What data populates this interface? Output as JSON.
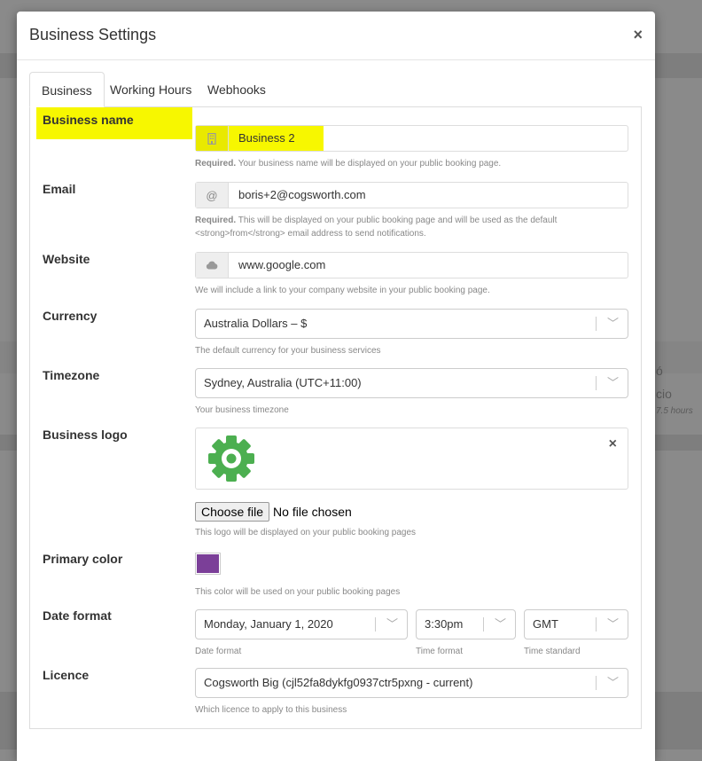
{
  "modal": {
    "title": "Business Settings",
    "close_label": "×"
  },
  "tabs": [
    {
      "label": "Business",
      "active": true
    },
    {
      "label": "Working Hours",
      "active": false
    },
    {
      "label": "Webhooks",
      "active": false
    }
  ],
  "fields": {
    "business_name": {
      "label": "Business name",
      "value": "Business 2",
      "icon": "building-icon",
      "help_strong": "Required.",
      "help": " Your business name will be displayed on your public booking page."
    },
    "email": {
      "label": "Email",
      "value": "boris+2@cogsworth.com",
      "icon": "at-icon",
      "help_strong": "Required.",
      "help": " This will be displayed on your public booking page and will be used as the default",
      "help_line2": "<strong>from</strong> email address to send notifications."
    },
    "website": {
      "label": "Website",
      "value": "www.google.com",
      "icon": "cloud-icon",
      "help": "We will include a link to your company website in your public booking page."
    },
    "currency": {
      "label": "Currency",
      "value": "Australia Dollars – $",
      "help": "The default currency for your business services"
    },
    "timezone": {
      "label": "Timezone",
      "value": "Sydney, Australia (UTC+11:00)",
      "help": "Your business timezone"
    },
    "logo": {
      "label": "Business logo",
      "remove_label": "×",
      "choose_file_label": "Choose file",
      "file_status": "No file chosen",
      "help": "This logo will be displayed on your public booking pages"
    },
    "primary_color": {
      "label": "Primary color",
      "value": "#7b3f98",
      "help": "This color will be used on your public booking pages"
    },
    "date_format": {
      "label": "Date format",
      "date_value": "Monday, January 1, 2020",
      "date_help": "Date format",
      "time_value": "3:30pm",
      "time_help": "Time format",
      "standard_value": "GMT",
      "standard_help": "Time standard"
    },
    "licence": {
      "label": "Licence",
      "value": "Cogsworth Big (cjl52fa8dykfg0937ctr5pxng - current)",
      "help": "Which licence to apply to this business"
    }
  },
  "background": {
    "text1": "ó",
    "text2": "cio",
    "text3": "7.5 hours"
  },
  "colors": {
    "highlight": "#f7f700",
    "logo_green": "#4caf50",
    "primary": "#7b3f98"
  }
}
